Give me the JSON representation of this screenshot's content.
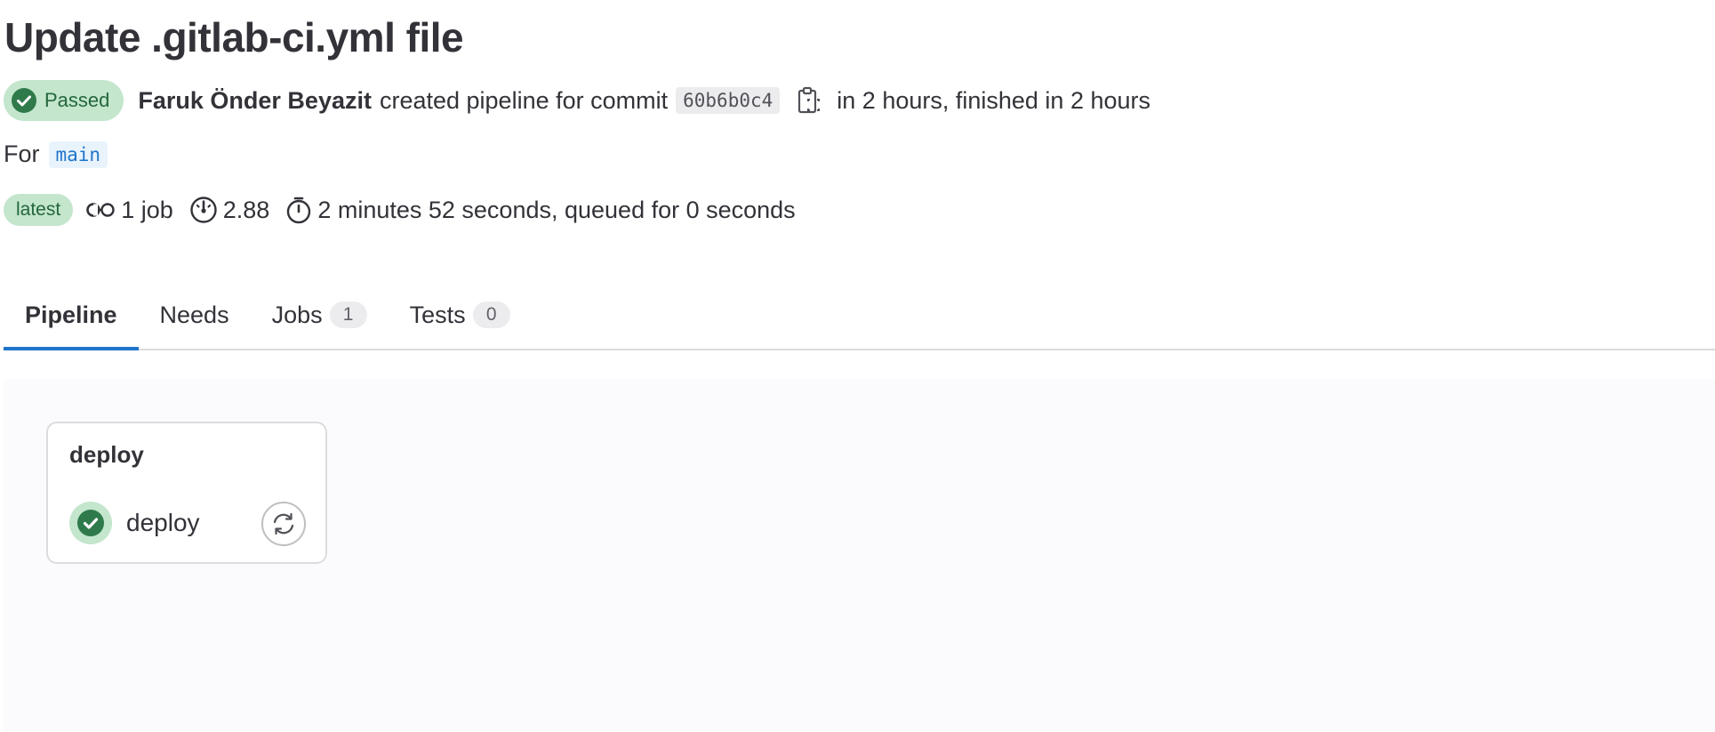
{
  "title": "Update .gitlab-ci.yml file",
  "status": {
    "badge_label": "Passed",
    "badge_icon": "check-circle-icon",
    "author": "Faruk Önder Beyazit",
    "action_text": "created pipeline for commit",
    "commit_sha": "60b6b0c4",
    "copy_icon": "copy-to-clipboard-icon",
    "timing_text": "in 2 hours, finished in 2 hours"
  },
  "branch": {
    "prefix": "For",
    "name": "main"
  },
  "meta": {
    "latest_label": "latest",
    "jobs_text": "1 job",
    "jobs_icon": "pipeline-icon",
    "compute_text": "2.88",
    "compute_icon": "dashboard-icon",
    "duration_text": "2 minutes 52 seconds, queued for 0 seconds",
    "duration_icon": "timer-icon"
  },
  "tabs": [
    {
      "label": "Pipeline",
      "active": true
    },
    {
      "label": "Needs",
      "active": false
    },
    {
      "label": "Jobs",
      "count": "1",
      "active": false
    },
    {
      "label": "Tests",
      "count": "0",
      "active": false
    }
  ],
  "graph": {
    "stages": [
      {
        "name": "deploy",
        "jobs": [
          {
            "name": "deploy",
            "status": "passed",
            "action_icon": "retry-icon"
          }
        ]
      }
    ]
  },
  "colors": {
    "success": "#108548",
    "success_bg": "#c3e6cd",
    "link": "#1f75cb",
    "text": "#333238"
  }
}
